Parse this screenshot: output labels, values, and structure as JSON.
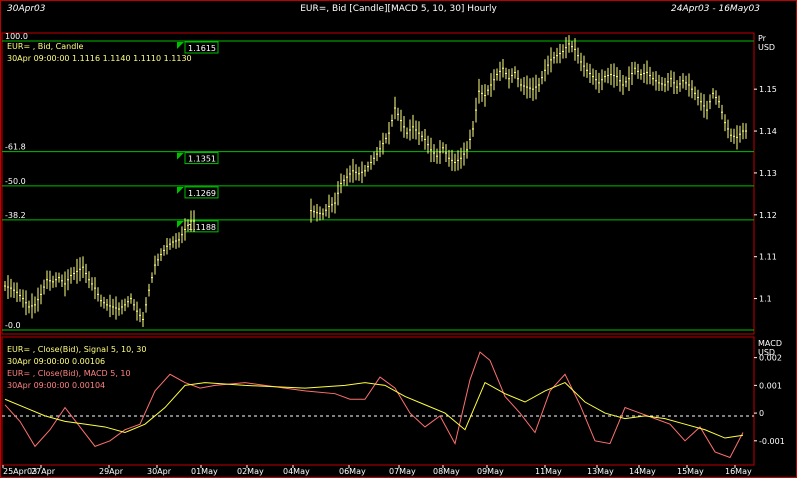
{
  "header": {
    "left": "30Apr03",
    "center": "EUR=, Bid [Candle][MACD 5, 10, 30] Hourly",
    "right": "24Apr03 - 16May03"
  },
  "colors": {
    "frame": "#c00000",
    "price_bars": "#ffff80",
    "fib_lines": "#00c000",
    "signal_line": "#ffff40",
    "macd_line": "#ff7070",
    "legend_label": "#ffff80",
    "macd_label": "#ff8080"
  },
  "price_panel": {
    "unit_label_1": "Pr",
    "unit_label_2": "USD",
    "legend_title": "EUR= , Bid, Candle",
    "legend_values": "30Apr 09:00:00 1.1116 1.1140 1.1110 1.1130",
    "axis_ticks": [
      "1.15",
      "1.14",
      "1.13",
      "1.12",
      "1.11",
      "1.1"
    ],
    "fib_levels": [
      {
        "label": "100.0",
        "price_tag": "1.1615",
        "price": 1.1615
      },
      {
        "label": "61.8",
        "price_tag": "1.1351",
        "price": 1.1351
      },
      {
        "label": "50.0",
        "price_tag": "1.1269",
        "price": 1.1269
      },
      {
        "label": "38.2",
        "price_tag": "1.1188",
        "price": 1.1188
      },
      {
        "label": "0.0",
        "price_tag": "",
        "price": 1.0925
      }
    ]
  },
  "macd_panel": {
    "unit_label_1": "MACD",
    "unit_label_2": "USD",
    "signal_title": "EUR= , Close(Bid), Signal 5, 10, 30",
    "signal_values": "30Apr 09:00:00 0.00106",
    "macd_title": "EUR= , Close(Bid), MACD 5, 10",
    "macd_values": "30Apr 09:00:00 0.00104",
    "axis_ticks": [
      "0.002",
      "0.001",
      "0",
      "-0.001"
    ]
  },
  "x_axis": {
    "labels": [
      "25Apr03",
      "27Apr",
      "29Apr",
      "30Apr",
      "01May",
      "02May",
      "04May",
      "06May",
      "07May",
      "08May",
      "09May",
      "11May",
      "13May",
      "14May",
      "15May",
      "16May"
    ]
  },
  "chart_data": [
    {
      "type": "line",
      "title": "EUR=, Bid [Candle] Hourly",
      "ylabel": "USD",
      "ylim": [
        1.0925,
        1.1615
      ],
      "x": [
        0,
        6,
        12,
        18,
        24,
        30,
        36,
        42,
        48,
        54,
        60,
        66,
        72,
        78,
        84,
        90,
        96,
        102,
        108,
        114,
        120,
        126,
        132,
        138,
        144,
        150,
        156,
        162,
        168,
        174,
        180,
        186,
        306,
        312,
        318,
        324,
        330,
        336,
        342,
        348,
        354,
        360,
        366,
        372,
        378,
        384,
        390,
        396,
        402,
        408,
        414,
        420,
        426,
        432,
        438,
        444,
        450,
        456,
        462,
        468,
        474,
        480,
        486,
        492,
        498,
        504,
        510,
        516,
        522,
        528,
        534,
        540,
        546,
        552,
        558,
        564,
        570,
        576,
        582,
        588,
        594,
        600,
        606,
        612,
        618,
        624,
        630,
        636,
        642,
        648,
        654,
        660,
        666,
        672,
        678,
        684,
        690,
        696,
        702,
        708,
        714,
        720,
        726,
        732,
        738
      ],
      "values": [
        1.103,
        1.1025,
        1.1015,
        1.1,
        1.098,
        1.0985,
        1.101,
        1.1045,
        1.104,
        1.105,
        1.1035,
        1.1055,
        1.1065,
        1.1075,
        1.1045,
        1.1025,
        1.0995,
        1.0985,
        1.098,
        1.0975,
        1.0985,
        1.1,
        1.097,
        1.095,
        1.102,
        1.108,
        1.1105,
        1.1125,
        1.1135,
        1.114,
        1.1165,
        1.1185,
        1.121,
        1.1205,
        1.1202,
        1.122,
        1.1228,
        1.1275,
        1.129,
        1.1305,
        1.1298,
        1.1305,
        1.1325,
        1.1345,
        1.137,
        1.1395,
        1.1455,
        1.1425,
        1.1395,
        1.141,
        1.1395,
        1.138,
        1.1355,
        1.134,
        1.136,
        1.1335,
        1.1325,
        1.1335,
        1.1355,
        1.1405,
        1.1495,
        1.1485,
        1.151,
        1.1535,
        1.155,
        1.1525,
        1.154,
        1.151,
        1.1505,
        1.15,
        1.151,
        1.1545,
        1.157,
        1.158,
        1.159,
        1.1608,
        1.1595,
        1.1565,
        1.1545,
        1.153,
        1.1515,
        1.153,
        1.1535,
        1.153,
        1.151,
        1.1525,
        1.155,
        1.1535,
        1.154,
        1.1525,
        1.1515,
        1.151,
        1.1525,
        1.1505,
        1.152,
        1.151,
        1.149,
        1.147,
        1.145,
        1.149,
        1.147,
        1.142,
        1.139,
        1.1385,
        1.14
      ]
    },
    {
      "type": "line",
      "title": "MACD 5, 10, 30",
      "ylabel": "USD",
      "ylim": [
        -0.0018,
        0.0026
      ],
      "series": [
        {
          "name": "EUR= , Close(Bid), Signal 5, 10, 30",
          "x": [
            0,
            20,
            40,
            60,
            80,
            100,
            120,
            140,
            160,
            180,
            200,
            240,
            300,
            340,
            360,
            380,
            400,
            420,
            440,
            460,
            480,
            500,
            520,
            540,
            560,
            580,
            600,
            620,
            640,
            660,
            680,
            700,
            720,
            738
          ],
          "values": [
            0.0005,
            0.0002,
            -0.0001,
            -0.0003,
            -0.0004,
            -0.0005,
            -0.0007,
            -0.0004,
            0.0002,
            0.001,
            0.0011,
            0.001,
            0.0009,
            0.001,
            0.0011,
            0.001,
            0.0006,
            0.0003,
            0.0,
            -0.0006,
            0.0011,
            0.0007,
            0.0004,
            0.0008,
            0.0011,
            0.0004,
            0.0,
            -0.0002,
            -0.0001,
            -0.0002,
            -0.0004,
            -0.0006,
            -0.0009,
            -0.0008
          ]
        },
        {
          "name": "EUR= , Close(Bid), MACD 5, 10",
          "x": [
            0,
            15,
            30,
            45,
            60,
            75,
            90,
            105,
            120,
            135,
            150,
            165,
            180,
            195,
            210,
            240,
            300,
            330,
            345,
            360,
            375,
            390,
            405,
            420,
            435,
            450,
            465,
            475,
            485,
            500,
            515,
            530,
            545,
            560,
            575,
            590,
            605,
            620,
            635,
            650,
            665,
            680,
            695,
            710,
            725,
            738
          ],
          "values": [
            0.0003,
            -0.0003,
            -0.0012,
            -0.0006,
            0.0002,
            -0.0005,
            -0.0012,
            -0.001,
            -0.0006,
            -0.0004,
            0.0008,
            0.0014,
            0.0011,
            0.0009,
            0.001,
            0.0011,
            0.0008,
            0.0007,
            0.0005,
            0.0005,
            0.0013,
            0.0009,
            0.0,
            -0.0005,
            -0.0001,
            -0.0011,
            0.0012,
            0.0022,
            0.0019,
            0.0006,
            0.0,
            -0.0007,
            0.0008,
            0.0014,
            0.0003,
            -0.001,
            -0.0011,
            0.0002,
            0.0,
            -0.0002,
            -0.0004,
            -0.001,
            -0.0005,
            -0.0014,
            -0.0016,
            -0.0007
          ]
        }
      ]
    }
  ]
}
